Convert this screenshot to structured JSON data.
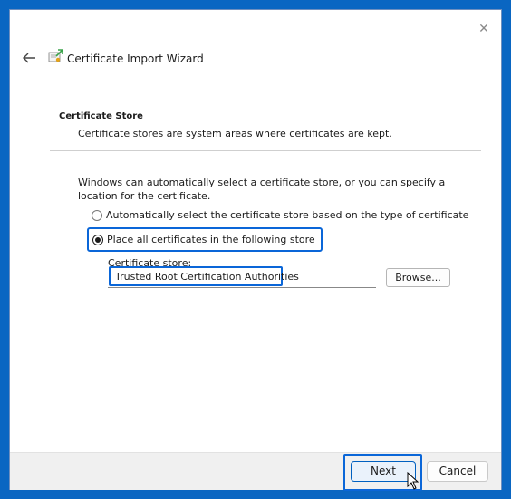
{
  "window": {
    "title": "Certificate Import Wizard",
    "close_glyph": "✕"
  },
  "section": {
    "title": "Certificate Store",
    "subtitle": "Certificate stores are system areas where certificates are kept."
  },
  "intro_text": "Windows can automatically select a certificate store, or you can specify a location for the certificate.",
  "options": {
    "auto_label": "Automatically select the certificate store based on the type of certificate",
    "manual_label": "Place all certificates in the following store",
    "selected": "manual"
  },
  "store": {
    "label": "Certificate store:",
    "value": "Trusted Root Certification Authorities",
    "browse_label": "Browse..."
  },
  "footer": {
    "next_label": "Next",
    "cancel_label": "Cancel"
  },
  "colors": {
    "desktop": "#0a66c2",
    "highlight": "#0a66d8",
    "footer_bg": "#f0f0f0"
  },
  "icons": [
    "close-icon",
    "back-arrow-icon",
    "certificate-wizard-icon",
    "mouse-cursor-icon"
  ]
}
